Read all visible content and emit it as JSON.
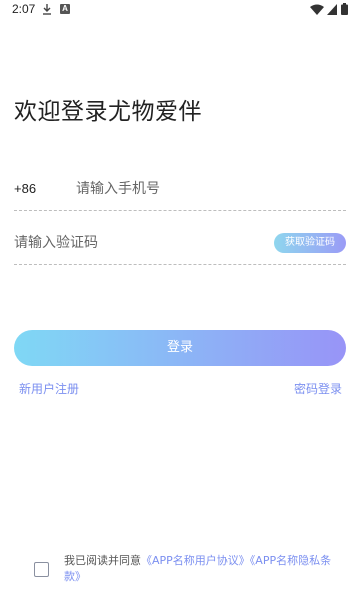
{
  "status_bar": {
    "time": "2:07",
    "icons": [
      "download-icon",
      "a-icon",
      "wifi-icon",
      "signal-icon",
      "battery-icon"
    ],
    "a_glyph": "A"
  },
  "login": {
    "title": "欢迎登录尤物爱伴",
    "phone": {
      "country_code": "+86",
      "value": "",
      "placeholder": "请输入手机号"
    },
    "code": {
      "value": "",
      "placeholder": "请输入验证码",
      "get_code_label": "获取验证码"
    },
    "submit_label": "登录",
    "register_label": "新用户注册",
    "password_login_label": "密码登录"
  },
  "agreement": {
    "checked": false,
    "prefix": "我已阅读并同意",
    "user_agreement": "《APP名称用户协议》",
    "privacy_policy": "《APP名称隐私条款》"
  },
  "colors": {
    "accent": "#7b8ff0",
    "gradient_start": "#7fd8f5",
    "gradient_end": "#9894f7",
    "divider": "#bdbdbd"
  }
}
